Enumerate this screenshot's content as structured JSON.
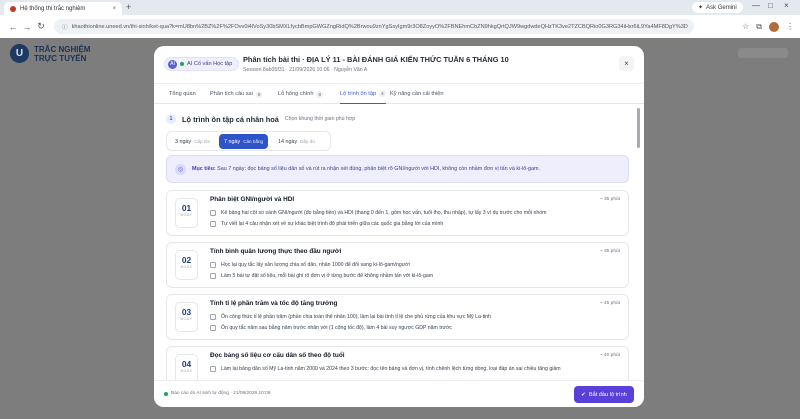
{
  "browser": {
    "tab_title": "Hệ thống thi trắc nghiệm",
    "tab_close": "×",
    "new_tab": "+",
    "gemini_label": "Ask Gemini",
    "url": "khaothionline.uneed.vn/thi-sinh/ket-qua?k=mU8bn%2BZ%2F%2FOvv0i4lVoSy30bSMXLfycbBmpGWGZngRidQ%2Brwou9znYgSsyIgm9r3O8ZoyyO%2FBNEhmCbZN9hkgQrtQJW9wgdwdeQHzTK3ve2TZCBQRio0G3RG34iHxr6iL9Ya4MF8DgY%3D",
    "window_controls": [
      "—",
      "□",
      "×"
    ]
  },
  "site": {
    "logo_letter": "U",
    "logo_line1": "TRẮC NGHIỆM",
    "logo_line2": "TRỰC TUYẾN"
  },
  "modal": {
    "ai_badge": "AI Cố vấn Học tập",
    "ai_icon": "AI",
    "title": "Phân tích bài thi · ĐỊA LÝ 11 - BÀI ĐÁNH GIÁ KIẾN THỨC TUẦN 6 THÁNG 10",
    "subtitle": "Session 8ab05f31 · 21/09/2026 10:06 · Nguyễn Văn A",
    "close": "×",
    "tabs": [
      {
        "label": "Tổng quan",
        "badge": ""
      },
      {
        "label": "Phân tích câu sai",
        "badge": "8"
      },
      {
        "label": "Lỗ hổng chính",
        "badge": "8"
      },
      {
        "label": "Lộ trình ôn tập",
        "badge": "4"
      },
      {
        "label": "Kỹ năng cần cải thiện",
        "badge": ""
      }
    ],
    "active_tab": 3,
    "section": {
      "number": "1",
      "title": "Lộ trình ôn tập cá nhân hoá",
      "hint": "Chọn khung thời gian phù hợp"
    },
    "durations": [
      {
        "label": "3 ngày",
        "sub": "Cấp tốc"
      },
      {
        "label": "7 ngày",
        "sub": "Cân bằng"
      },
      {
        "label": "14 ngày",
        "sub": "Đầy đủ"
      }
    ],
    "active_duration": 1,
    "goal": {
      "icon": "◎",
      "label": "Mục tiêu:",
      "text": "Sau 7 ngày: đọc bảng số liệu dân số và rút ra nhận xét đúng, phân biệt rõ GNI/người với HDI, không còn nhầm đơn vị tấn và ki-lô-gam."
    },
    "day_label": "NGÀY",
    "days": [
      {
        "num": "01",
        "title": "Phân biệt GNI/người và HDI",
        "time": "~ 35 phút",
        "tasks": [
          "Kẻ bảng hai cột so sánh GNI/người (đo bằng tiền) và HDI (thang 0 đến 1, gồm học vấn, tuổi thọ, thu nhập), tự lấy 3 ví dụ trước cho mỗi nhóm",
          "Tự viết lại 4 câu nhận xét về sự khác biệt trình độ phát triển giữa các quốc gia bằng lời của mình"
        ]
      },
      {
        "num": "02",
        "title": "Tính bình quân lương thực theo đầu người",
        "time": "~ 35 phút",
        "tasks": [
          "Học lại quy tắc lấy sản lượng chia số dân, nhân 1000 để đổi sang ki-lô-gam/người",
          "Làm 5 bài tự đặt số liệu, mỗi bài ghi rõ đơn vị ở từng bước để không nhầm tấn với ki-lô-gam"
        ]
      },
      {
        "num": "03",
        "title": "Tính tỉ lệ phần trăm và tốc độ tăng trưởng",
        "time": "~ 45 phút",
        "tasks": [
          "Ôn công thức tỉ lệ phần trăm (phần chia toàn thể nhân 100), làm lại bài tính tỉ lệ che phủ rừng của khu vực Mỹ La-tinh",
          "Ôn quy tắc năm sau bằng năm trước nhân với (1 cộng tốc độ), làm 4 bài suy ngược GDP năm trước"
        ]
      },
      {
        "num": "04",
        "title": "Đọc bảng số liệu cơ cấu dân số theo độ tuổi",
        "time": "~ 40 phút",
        "tasks": [
          "Làm lại bảng dân số Mỹ La-tinh năm 2000 và 2024 theo 3 bước: đọc tên bảng và đơn vị, tính chênh lệch từng dòng, loại đáp án sai chiều tăng giảm"
        ]
      }
    ],
    "footer_status": "Báo cáo do AI sinh tự động · 21/09/2026 10:06",
    "start_button": "Bắt đầu lộ trình",
    "start_icon": "✔"
  }
}
